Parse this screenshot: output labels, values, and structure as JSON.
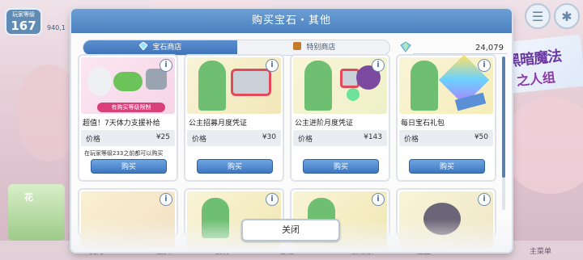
{
  "player": {
    "level_label": "玩家等级",
    "level": "167",
    "bg_value": "940,1"
  },
  "modal": {
    "title": "购买宝石・其他",
    "tabs": [
      {
        "label": "宝石商店"
      },
      {
        "label": "特别商店"
      }
    ],
    "gem_balance": "24,079",
    "close_label": "关闭"
  },
  "cards": [
    {
      "name": "超值！7天体力支援补给",
      "price_label": "价格",
      "price": "¥25",
      "tag": "有购买等级限制",
      "note": "在玩家等级233之前都可以购买",
      "buy_label": "购买"
    },
    {
      "name": "公主招募月度凭证",
      "price_label": "价格",
      "price": "¥30",
      "buy_label": "购买"
    },
    {
      "name": "公主进阶月度凭证",
      "price_label": "价格",
      "price": "¥143",
      "buy_label": "购买"
    },
    {
      "name": "每日宝石礼包",
      "price_label": "价格",
      "price": "¥50",
      "buy_label": "购买"
    }
  ],
  "bottom_nav": [
    "我的",
    "主页",
    "剧情",
    "冒险",
    "公会之家",
    "扭蛋",
    "主菜单"
  ],
  "colors": {
    "accent": "#4b80bf",
    "tag": "#d9407a"
  }
}
